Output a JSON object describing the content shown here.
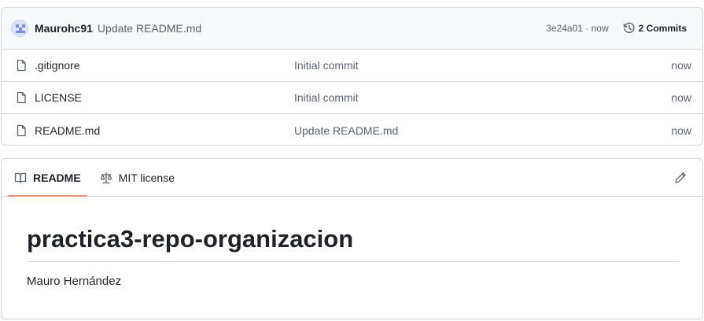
{
  "commit_bar": {
    "author": "Maurohc91",
    "message": "Update README.md",
    "sha_time": "3e24a01 · now",
    "commits_label": "2 Commits",
    "avatar_icon": "identicon-avatar",
    "history_icon": "history-icon"
  },
  "files": [
    {
      "name": ".gitignore",
      "commit": "Initial commit",
      "time": "now",
      "icon": "file-icon"
    },
    {
      "name": "LICENSE",
      "commit": "Initial commit",
      "time": "now",
      "icon": "file-icon"
    },
    {
      "name": "README.md",
      "commit": "Update README.md",
      "time": "now",
      "icon": "file-icon"
    }
  ],
  "readme": {
    "tabs": [
      {
        "label": "README",
        "icon": "book-icon",
        "active": true
      },
      {
        "label": "MIT license",
        "icon": "law-icon",
        "active": false
      }
    ],
    "edit_icon": "pencil-icon",
    "title": "practica3-repo-organizacion",
    "text": "Mauro Hernández"
  },
  "colors": {
    "border": "#d0d7de",
    "header_bg": "#f6f8fa",
    "muted_text": "#59636e",
    "active_tab_underline": "#fd8c73"
  }
}
